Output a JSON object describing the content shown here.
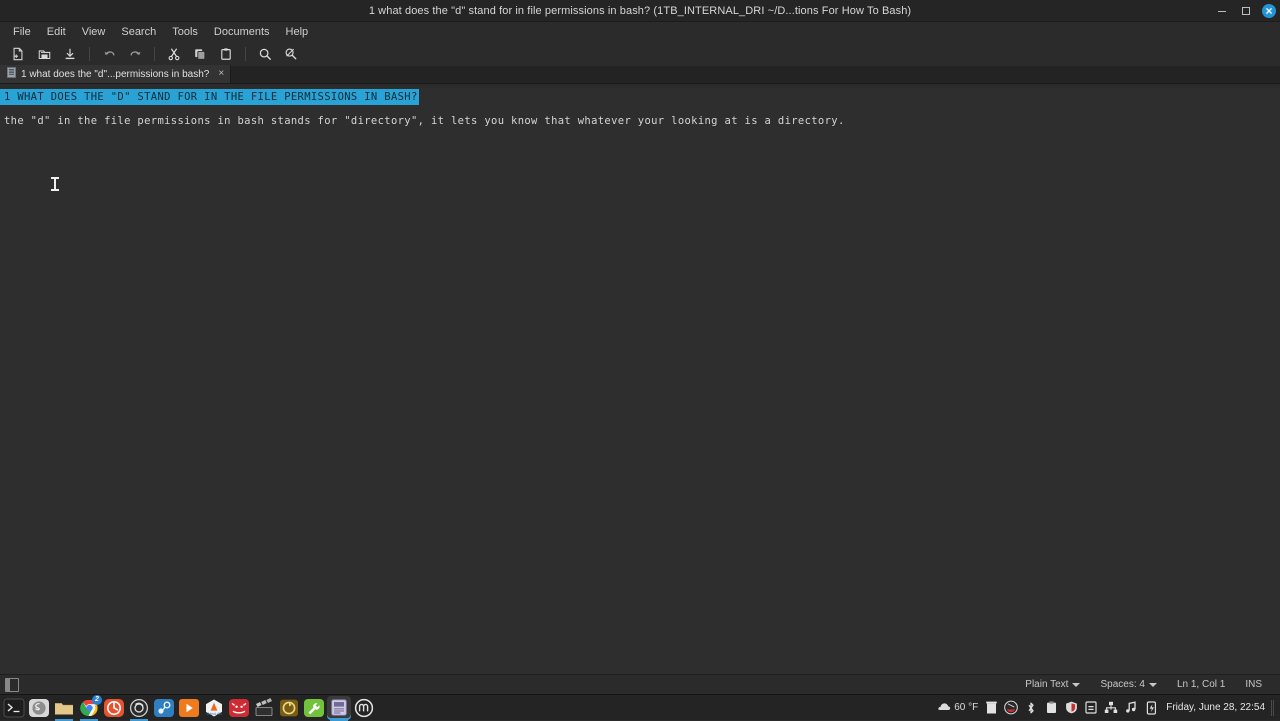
{
  "window": {
    "title": "1 what does the \"d\" stand for in file permissions in bash? (1TB_INTERNAL_DRI ~/D...tions For How To Bash)",
    "controls": {
      "minimize": "minimize",
      "maximize": "maximize",
      "close": "×"
    }
  },
  "menubar": {
    "items": [
      {
        "label": "File"
      },
      {
        "label": "Edit"
      },
      {
        "label": "View"
      },
      {
        "label": "Search"
      },
      {
        "label": "Tools"
      },
      {
        "label": "Documents"
      },
      {
        "label": "Help"
      }
    ]
  },
  "toolbar": {
    "buttons": [
      {
        "name": "new-document-icon"
      },
      {
        "name": "open-document-icon"
      },
      {
        "name": "save-document-icon"
      },
      {
        "name": "undo-icon"
      },
      {
        "name": "redo-icon"
      },
      {
        "name": "cut-icon"
      },
      {
        "name": "copy-icon"
      },
      {
        "name": "paste-icon"
      },
      {
        "name": "find-icon"
      },
      {
        "name": "find-replace-icon"
      }
    ]
  },
  "tabs": [
    {
      "label": "1 what does the \"d\"...permissions in bash?",
      "close": "×",
      "active": true
    }
  ],
  "editor": {
    "lines": [
      {
        "text": "1 WHAT DOES THE \"D\" STAND FOR IN THE FILE PERMISSIONS IN BASH?",
        "selected": true
      },
      {
        "text": "the \"d\" in the file permissions in bash stands for \"directory\", it lets you know that whatever your looking at is a directory.",
        "selected": false
      }
    ],
    "selection_color": "#29a3d6",
    "background_color": "#2e2e2e"
  },
  "statusbar": {
    "panel_toggle": "side-panel-toggle",
    "language": "Plain Text",
    "indentation": "Spaces: 4",
    "position": "Ln 1, Col 1",
    "insert_mode": "INS"
  },
  "taskbar": {
    "launchers": [
      {
        "name": "terminal",
        "label": ""
      },
      {
        "name": "messaging-app",
        "label": ""
      },
      {
        "name": "file-manager",
        "label": ""
      },
      {
        "name": "chrome-browser",
        "label": "",
        "badge": "2"
      },
      {
        "name": "firefox-browser",
        "label": ""
      },
      {
        "name": "obs-studio",
        "label": ""
      },
      {
        "name": "steam",
        "label": ""
      },
      {
        "name": "media-player",
        "label": ""
      },
      {
        "name": "vlc-player",
        "label": ""
      },
      {
        "name": "audacity-app",
        "label": ""
      },
      {
        "name": "video-editor",
        "label": ""
      },
      {
        "name": "retro-app",
        "label": ""
      },
      {
        "name": "tools-app",
        "label": ""
      },
      {
        "name": "text-editor",
        "label": "",
        "active": true
      },
      {
        "name": "linux-mint-menu",
        "label": ""
      }
    ],
    "tray": {
      "weather": "60 °F",
      "icons": [
        "trash-icon",
        "system-app-icon",
        "bluetooth-icon",
        "clipboard-icon",
        "shield-icon",
        "notes-icon",
        "network-icon",
        "volume-music-icon",
        "power-icon"
      ],
      "clock": "Friday, June 28, 22:54"
    }
  }
}
